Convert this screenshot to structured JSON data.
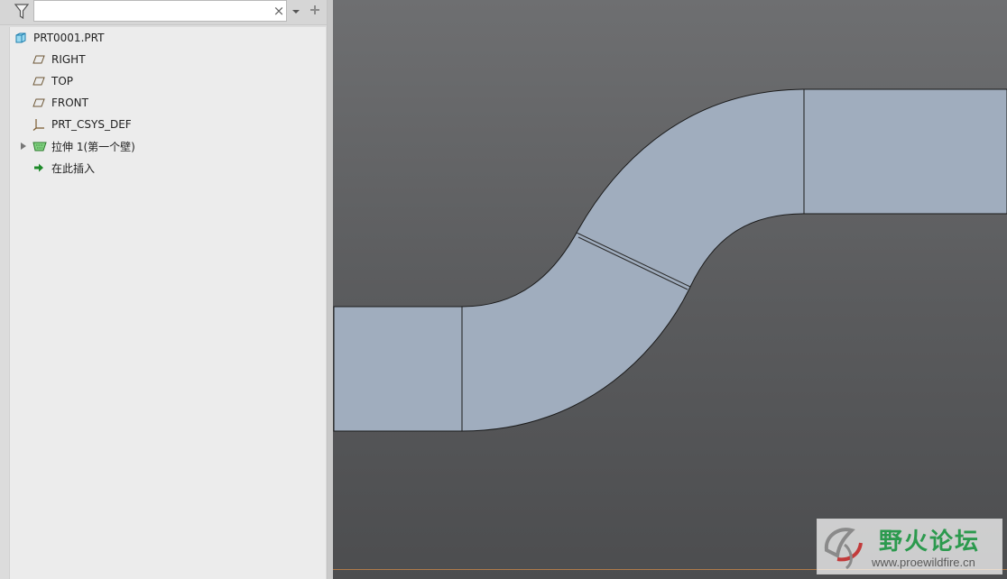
{
  "tree": {
    "search": {
      "value": "",
      "clear_glyph": "×"
    },
    "items": [
      {
        "label": "PRT0001.PRT",
        "icon": "part-icon"
      },
      {
        "label": "RIGHT",
        "icon": "datum-plane-icon"
      },
      {
        "label": "TOP",
        "icon": "datum-plane-icon"
      },
      {
        "label": "FRONT",
        "icon": "datum-plane-icon"
      },
      {
        "label": "PRT_CSYS_DEF",
        "icon": "csys-icon"
      },
      {
        "label": "拉伸 1(第一个壁)",
        "icon": "extrude-wall-icon"
      },
      {
        "label": "在此插入",
        "icon": "insert-here-arrow-icon"
      }
    ]
  },
  "watermark": {
    "title": "野火论坛",
    "url": "www.proewildfire.cn"
  },
  "colors": {
    "viewport_top": "#6e6f71",
    "viewport_bottom": "#4c4d4f",
    "model_fill": "#a0adbe",
    "model_edge": "#1a1a1a",
    "watermark_green": "#2c9a4e"
  }
}
